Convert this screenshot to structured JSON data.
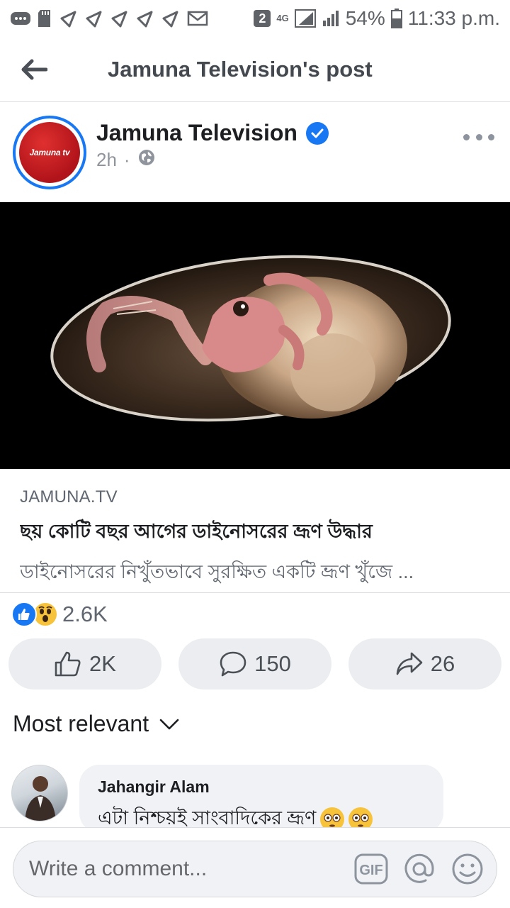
{
  "status_bar": {
    "sim_badge": "2",
    "network": "4G",
    "battery": "54%",
    "time": "11:33 p.m."
  },
  "header": {
    "title": "Jamuna Television's post"
  },
  "post": {
    "page_name": "Jamuna Television",
    "avatar_text": "Jamuna tv",
    "time_ago": "2h",
    "separator": "·",
    "verified": true
  },
  "link_preview": {
    "domain": "JAMUNA.TV",
    "title": "ছয় কোটি বছর আগের ডাইনোসরের ভ্রূণ উদ্ধার",
    "description": "ডাইনোসরের নিখুঁতভাবে সুরক্ষিত একটি ভ্রূণ খুঁজে ..."
  },
  "reactions": {
    "count": "2.6K",
    "types": [
      "like",
      "wow"
    ]
  },
  "actions": {
    "like_count": "2K",
    "comment_count": "150",
    "share_count": "26"
  },
  "comments": {
    "sort_label": "Most relevant",
    "items": [
      {
        "author": "Jahangir Alam",
        "text": "এটা নিশ্চয়ই সাংবাদিকের ভ্রূণ"
      }
    ]
  },
  "composer": {
    "placeholder": "Write a comment...",
    "gif_label": "GIF"
  },
  "colors": {
    "brand_blue": "#1877f2",
    "avatar_red": "#c8151c",
    "wow_yellow": "#f7c33b",
    "button_bg": "#ebedf0"
  }
}
